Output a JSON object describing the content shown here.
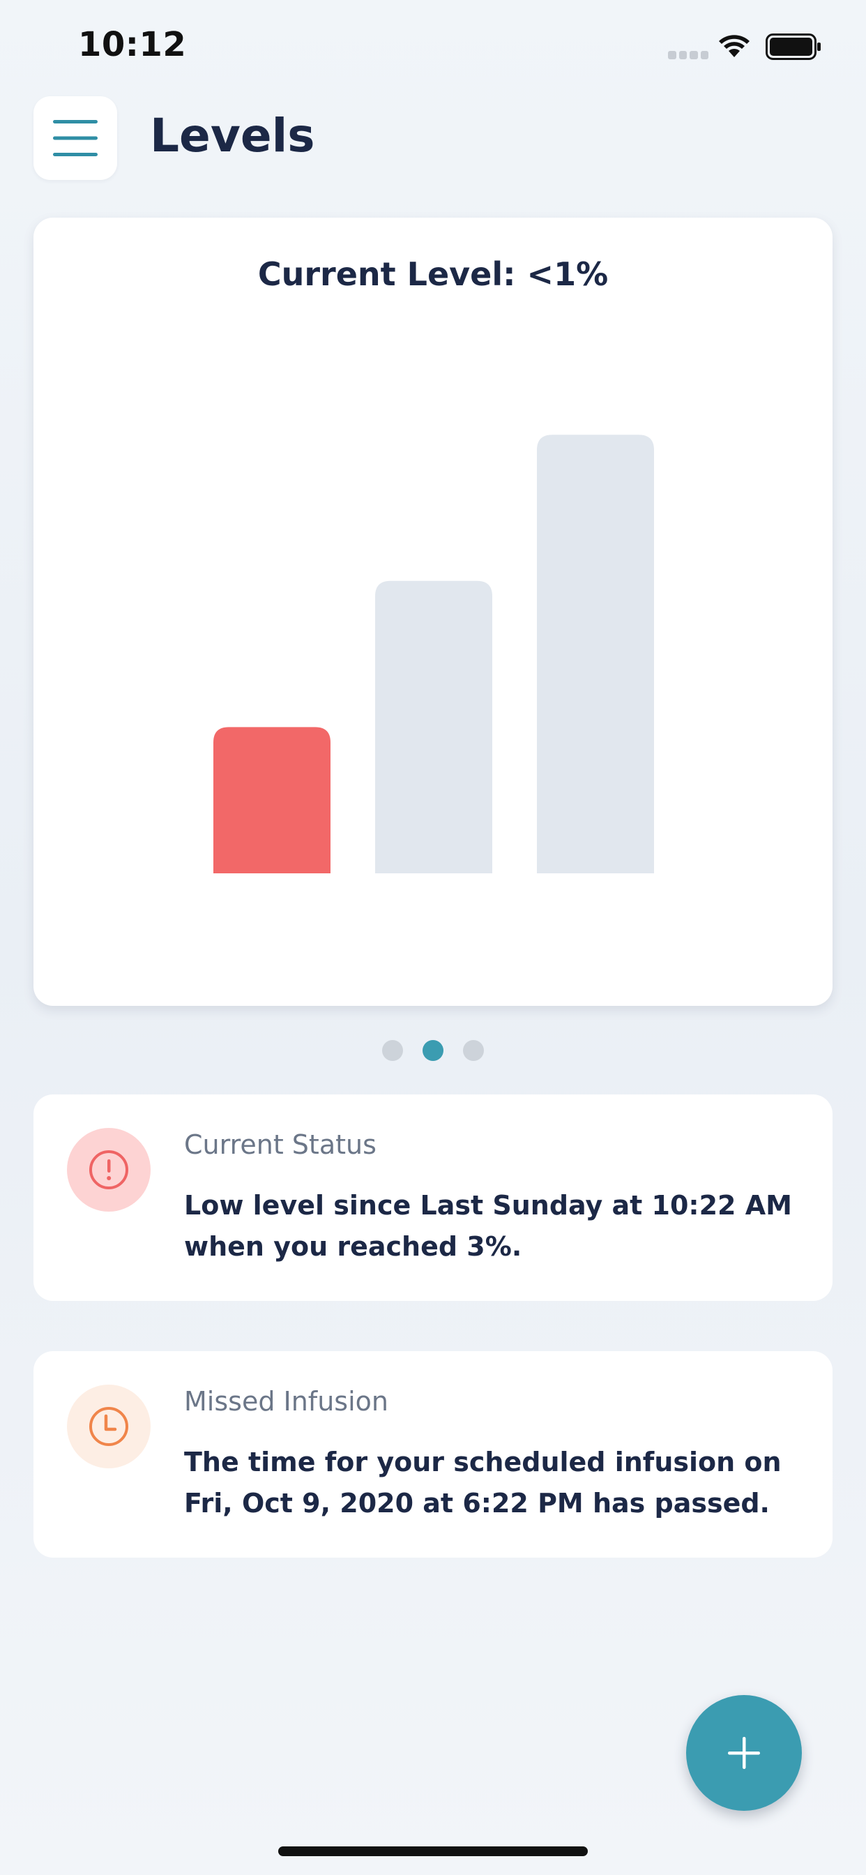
{
  "status_bar": {
    "time": "10:12",
    "icons": [
      "signal-icon",
      "wifi-icon",
      "battery-icon"
    ]
  },
  "header": {
    "title": "Levels",
    "menu_icon": "hamburger-menu-icon"
  },
  "chart": {
    "title": "Current Level: <1%",
    "colors": {
      "current": "#f26868",
      "inactive": "#e1e7ee"
    }
  },
  "chart_data": {
    "type": "bar",
    "title": "Current Level: <1%",
    "categories": [
      "",
      "",
      ""
    ],
    "values": [
      1,
      2,
      3
    ],
    "highlighted_index": 0,
    "ylim": [
      0,
      3.75
    ],
    "grid": false,
    "legend": "none"
  },
  "pager": {
    "count": 3,
    "active_index": 1
  },
  "status_card": {
    "icon": "alert-circle-icon",
    "label": "Current Status",
    "body": "Low level since Last Sunday at 10:22 AM when you reached 3%."
  },
  "infusion_card": {
    "icon": "clock-icon",
    "label": "Missed Infusion",
    "body": "The time for your scheduled infusion on Fri, Oct 9, 2020 at 6:22 PM has passed."
  },
  "fab": {
    "icon": "plus-icon"
  },
  "theme": {
    "accent": "#3b9cb1",
    "alert": "#f26868",
    "warning": "#f0854a",
    "text_dark": "#1c2846",
    "text_muted": "#6b7688"
  }
}
